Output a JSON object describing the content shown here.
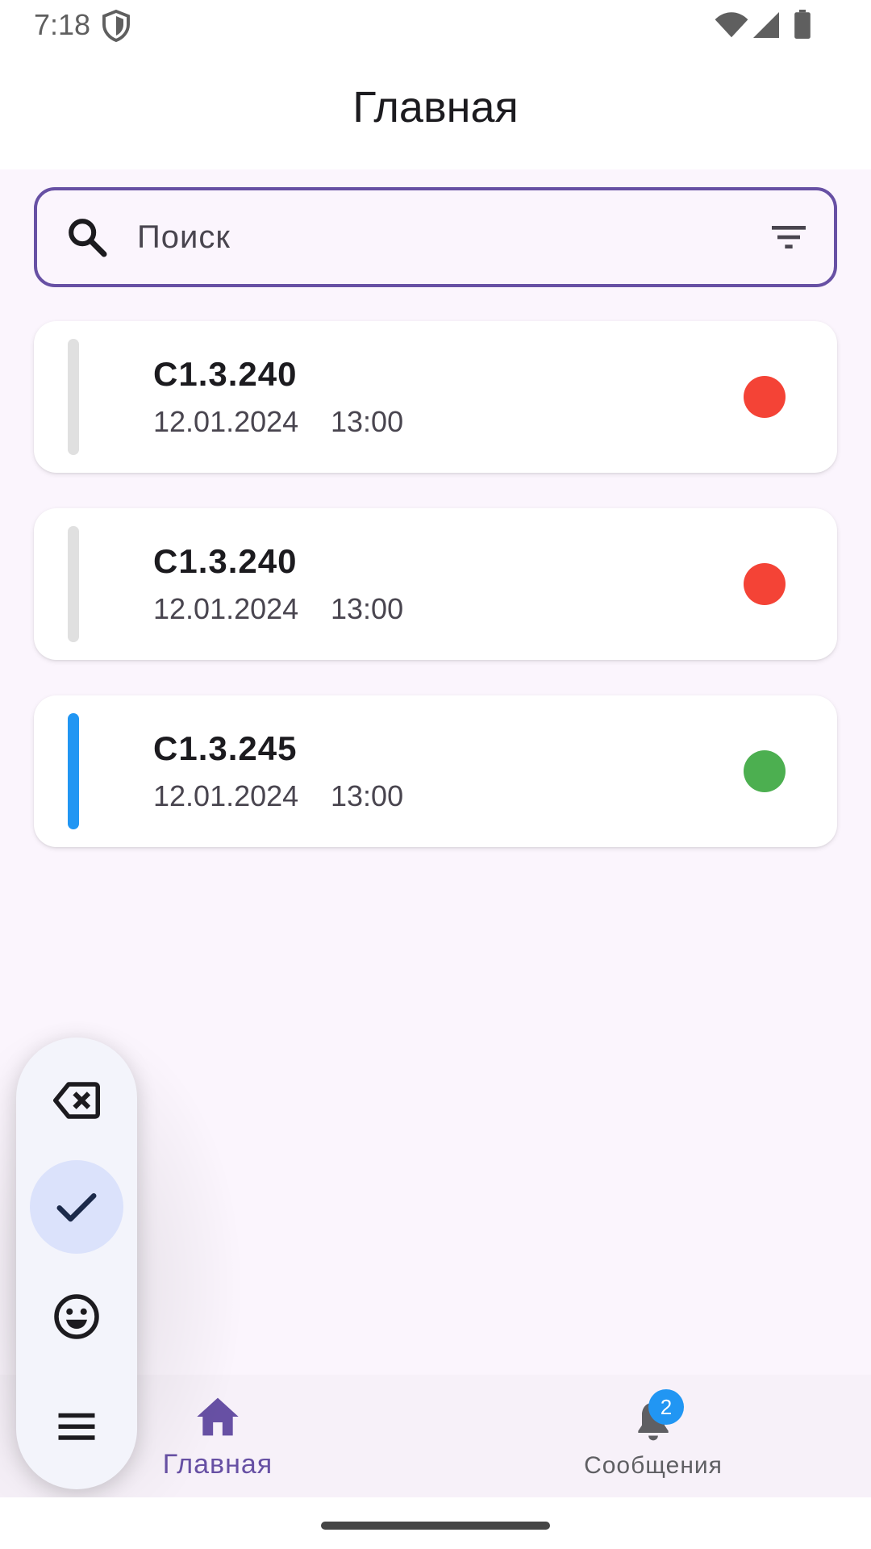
{
  "status_bar": {
    "time": "7:18",
    "icons": [
      "shield-icon",
      "wifi-icon",
      "signal-icon",
      "battery-icon"
    ]
  },
  "header": {
    "title": "Главная"
  },
  "search": {
    "placeholder": "Поиск",
    "icon": "search-icon",
    "filter_icon": "filter-icon"
  },
  "items": [
    {
      "title": "С1.3.240",
      "date": "12.01.2024",
      "time": "13:00",
      "status_color": "#f44336",
      "bar_color": "#e0e0e0"
    },
    {
      "title": "С1.3.240",
      "date": "12.01.2024",
      "time": "13:00",
      "status_color": "#f44336",
      "bar_color": "#e0e0e0"
    },
    {
      "title": "С1.3.245",
      "date": "12.01.2024",
      "time": "13:00",
      "status_color": "#4caf50",
      "bar_color": "#2196f3"
    }
  ],
  "keyboard_toolbar": {
    "buttons": [
      "backspace-icon",
      "check-icon",
      "emoji-icon",
      "menu-icon"
    ],
    "active": "check-icon"
  },
  "bottom_nav": {
    "home_label": "Главная",
    "messages_label": "Сообщения",
    "messages_badge": "2"
  },
  "colors": {
    "accent": "#6750a4",
    "badge": "#2196f3",
    "status_red": "#f44336",
    "status_green": "#4caf50"
  }
}
